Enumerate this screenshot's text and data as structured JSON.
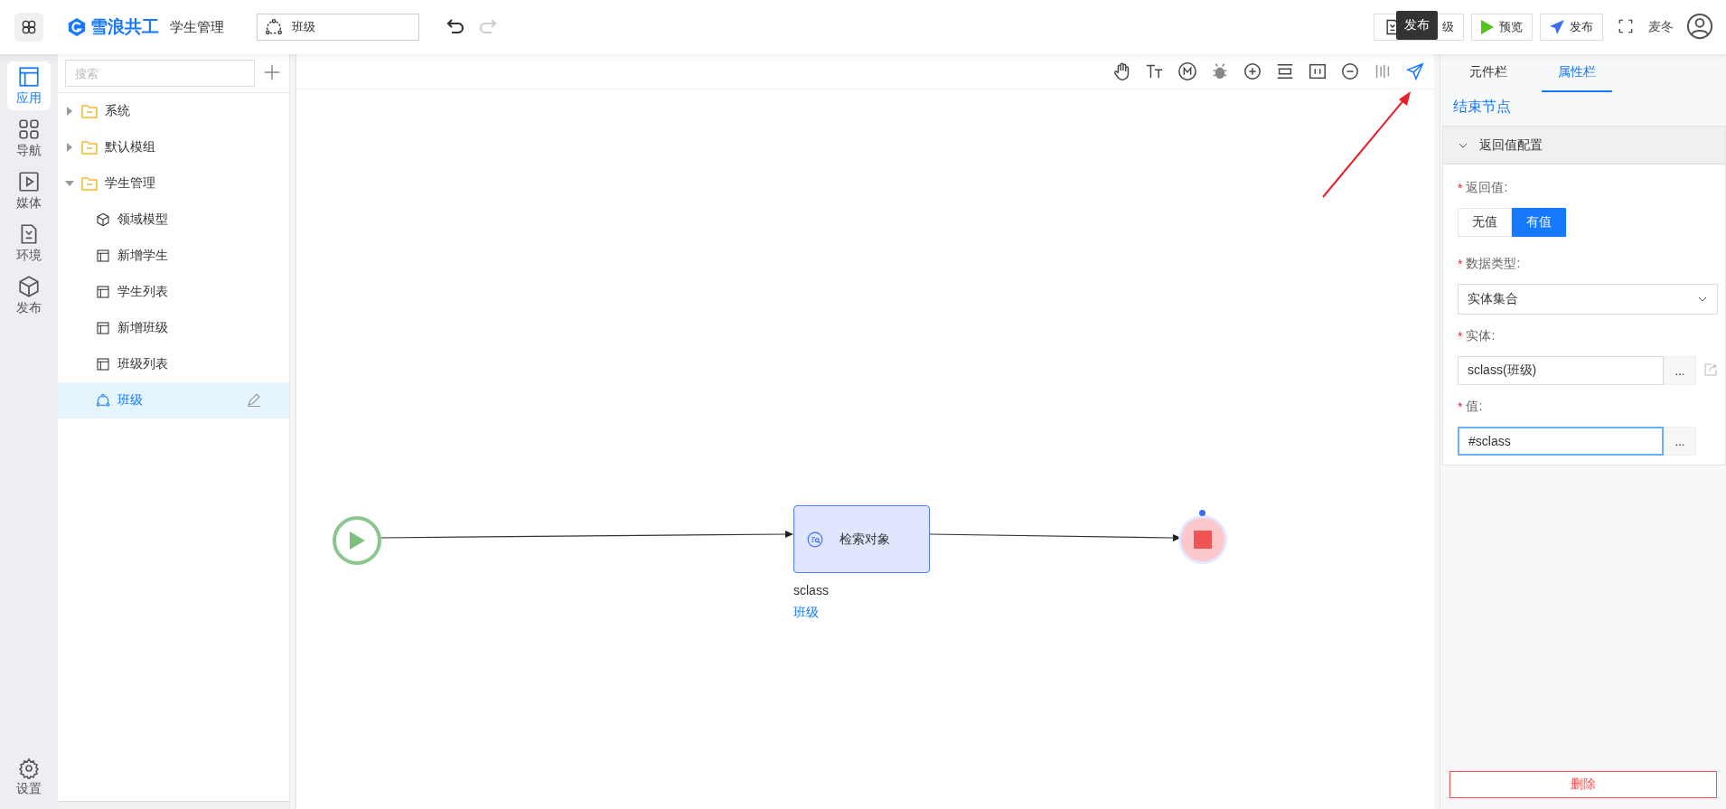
{
  "header": {
    "logo": "雪浪共工",
    "app_name": "学生管理",
    "current_page": "班级",
    "user": "麦冬",
    "buttons": [
      {
        "label": "级",
        "kind": "env"
      },
      {
        "label": "预览",
        "kind": "preview"
      },
      {
        "label": "发布",
        "kind": "publish"
      }
    ]
  },
  "tooltip": "发布",
  "rail": [
    {
      "label": "应用",
      "kind": "app",
      "selected": true
    },
    {
      "label": "导航",
      "kind": "nav",
      "selected": false
    },
    {
      "label": "媒体",
      "kind": "media",
      "selected": false
    },
    {
      "label": "环境",
      "kind": "env",
      "selected": false
    },
    {
      "label": "发布",
      "kind": "publish",
      "selected": false
    }
  ],
  "rail_bottom": {
    "label": "设置"
  },
  "tree": {
    "search_placeholder": "搜索",
    "items": [
      {
        "label": "系统",
        "kind": "folder",
        "expanded": false,
        "selected": false
      },
      {
        "label": "默认模组",
        "kind": "folder",
        "expanded": false,
        "selected": false
      },
      {
        "label": "学生管理",
        "kind": "folder",
        "expanded": true,
        "selected": false,
        "children": [
          {
            "label": "领域模型",
            "kind": "model",
            "selected": false
          },
          {
            "label": "新增学生",
            "kind": "page",
            "selected": false
          },
          {
            "label": "学生列表",
            "kind": "page",
            "selected": false
          },
          {
            "label": "新增班级",
            "kind": "page",
            "selected": false
          },
          {
            "label": "班级列表",
            "kind": "page",
            "selected": false
          },
          {
            "label": "班级",
            "kind": "flow",
            "selected": true
          }
        ]
      }
    ]
  },
  "flow": {
    "task": {
      "label": "检索对象",
      "variable": "sclass",
      "entity": "班级"
    }
  },
  "right_panel": {
    "tabs": [
      {
        "label": "元件栏",
        "selected": false
      },
      {
        "label": "属性栏",
        "selected": true
      }
    ],
    "node_title": "结束节点",
    "section": {
      "title": "返回值配置",
      "expanded": true,
      "fields": [
        {
          "kind": "toggle",
          "mark": "*",
          "label": "返回值:",
          "options": [
            {
              "label": "无值",
              "selected": false
            },
            {
              "label": "有值",
              "selected": true
            }
          ]
        },
        {
          "kind": "select",
          "mark": "*",
          "label": "数据类型:",
          "value": "实体集合"
        },
        {
          "kind": "picker",
          "mark": "*",
          "label": "实体:",
          "value": "sclass(班级)",
          "button": "...",
          "link": true,
          "focused": false
        },
        {
          "kind": "picker",
          "mark": "*",
          "label": "值:",
          "value": "#sclass",
          "button": "...",
          "link": false,
          "focused": true
        }
      ]
    },
    "delete_button": "删除"
  }
}
